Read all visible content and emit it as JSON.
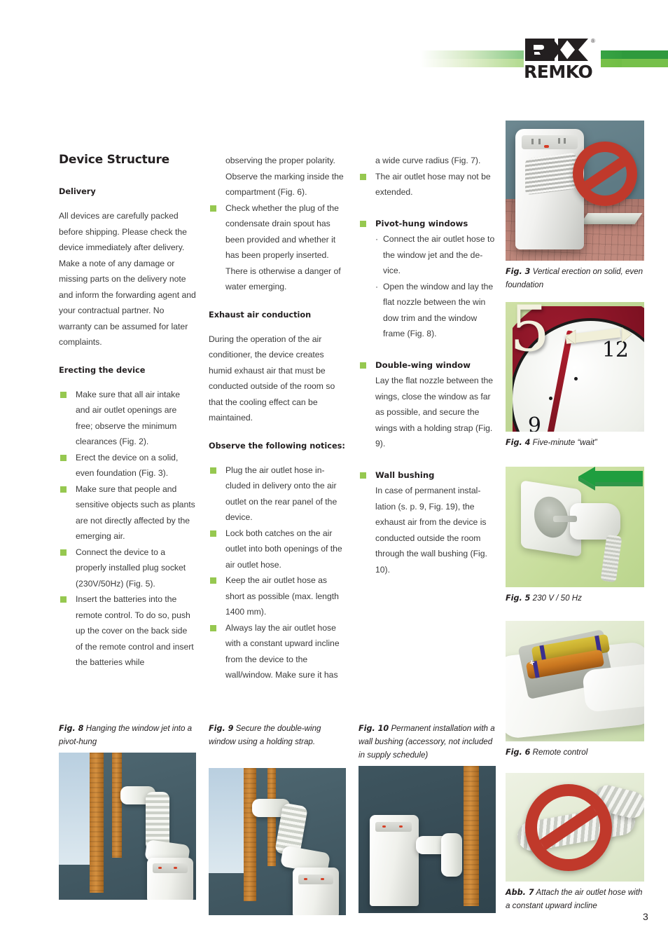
{
  "brand": {
    "logo_text": "REMKO",
    "registered_mark": "®",
    "accent_dark": "#2f9a3d",
    "accent_light": "#76c04a",
    "bullet_green": "#96c850"
  },
  "column1": {
    "section_title": "Device Structure",
    "delivery_heading": "Delivery",
    "delivery_body": "All devices are carefully packed before shipping. Please check the device immediately after delivery. Make a note of any damage or missing parts on the delivery note and inform the forwarding agent and your contractual partner. No warranty can be assumed for later complaints.",
    "erecting_heading": "Erecting the device",
    "erecting_bullets": [
      "Make sure that all air intake and air outlet openings are free; observe the minimum clearances (Fig. 2).",
      "Erect the device on a solid, even foundation (Fig. 3).",
      "Make sure that people and sensitive objects such as plants are not directly affected by the emerging air.",
      "Connect the device to a properly installed plug socket (230V/50Hz) (Fig. 5).",
      "Insert the batteries into the remote control. To do so, push up the cover on the back side of the remote control and insert the batteries while"
    ]
  },
  "column2": {
    "continuation": "observing the proper polarity. Observe the marking inside the compartment (Fig. 6).",
    "bullets_top": [
      "Check whether the plug of the condensate drain spout has been provided and whether it has been properly inserted. There is otherwise a danger of water emerging."
    ],
    "exhaust_heading": "Exhaust air conduction",
    "exhaust_body": "During the operation of the air conditioner, the device creates humid exhaust air that must be conducted outside of the room so that the cooling effect can be maintained.",
    "notices_heading": "Observe the following notices:",
    "notice_bullets": [
      "Plug the air outlet hose in-cluded in delivery onto the air outlet on the rear panel of the device.",
      "Lock both catches on the air outlet into both openings of the air outlet hose.",
      "Keep the air outlet hose as short as possible (max. length 1400 mm).",
      "Always lay the air outlet hose with a constant upward incline from the device to the wall/window. Make sure it has"
    ]
  },
  "column3": {
    "continuation": "a wide curve radius (Fig. 7).",
    "bullets_top": [
      "The air outlet hose may not be extended."
    ],
    "pivot_heading": "Pivot-hung windows",
    "pivot_items": [
      "Connect the air outlet hose to the window jet and the de-vice.",
      "Open the window and lay the flat nozzle between the win dow trim and the window frame (Fig. 8)."
    ],
    "double_heading": "Double-wing window",
    "double_body": "Lay the flat nozzle between the wings, close the window as far as possible, and secure the wings with a holding strap (Fig. 9).",
    "wall_heading": "Wall bushing",
    "wall_body": "In case of permanent instal-lation (s. p. 9, Fig. 19), the exhaust air from the device is conducted outside the room through the wall bushing (Fig. 10)."
  },
  "figures": {
    "fig3": {
      "label": "Fig. 3",
      "caption": "Vertical erection on solid, even foundation",
      "alt": "air-conditioner-tilted-on-slab-prohibited"
    },
    "fig4": {
      "label": "Fig. 4",
      "caption": "Five-minute “wait”",
      "alt": "clock-face-with-number-five",
      "big_number": "5",
      "clock_numerals": [
        "12",
        "9"
      ]
    },
    "fig5": {
      "label": "Fig. 5",
      "caption": "230 V / 50 Hz",
      "alt": "plug-inserted-into-wall-socket-green-arrow"
    },
    "fig6": {
      "label": "Fig. 6",
      "caption": "Remote control",
      "alt": "remote-control-battery-compartment",
      "battery_marks": [
        "+",
        "+"
      ]
    },
    "fig7": {
      "label": "Abb. 7",
      "caption": "Attach the air outlet hose with a constant upward incline",
      "alt": "flexible-hose-prohibited-red-circle"
    },
    "fig8": {
      "label": "Fig. 8",
      "caption": "Hanging the window jet into a pivot-hung",
      "alt": "window-jet-in-pivot-hung-window"
    },
    "fig9": {
      "label": "Fig. 9",
      "caption": "Secure the double-wing window using a holding strap.",
      "alt": "double-wing-window-with-holding-strap"
    },
    "fig10": {
      "label": "Fig. 10",
      "caption": "Permanent installation with a wall bushing (accessory, not included in supply schedule)",
      "alt": "permanent-wall-bushing-installation"
    }
  },
  "footer": {
    "page_number": "3"
  }
}
